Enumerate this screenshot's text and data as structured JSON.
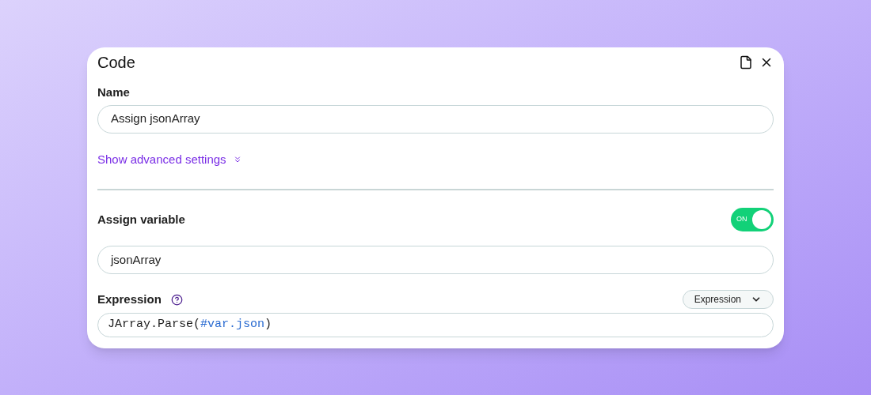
{
  "dialog": {
    "title": "Code"
  },
  "name_field": {
    "label": "Name",
    "value": "Assign jsonArray"
  },
  "advanced_link": {
    "label": "Show advanced settings",
    "expanded": false
  },
  "assign_variable": {
    "label": "Assign variable",
    "toggle": {
      "on": true,
      "label": "ON"
    },
    "value": "jsonArray"
  },
  "expression": {
    "label": "Expression",
    "mode_dropdown": "Expression",
    "code_parts": [
      {
        "text": "JArray.Parse(",
        "kind": "plain"
      },
      {
        "text": "#var.json",
        "kind": "variable"
      },
      {
        "text": ")",
        "kind": "plain"
      }
    ]
  }
}
